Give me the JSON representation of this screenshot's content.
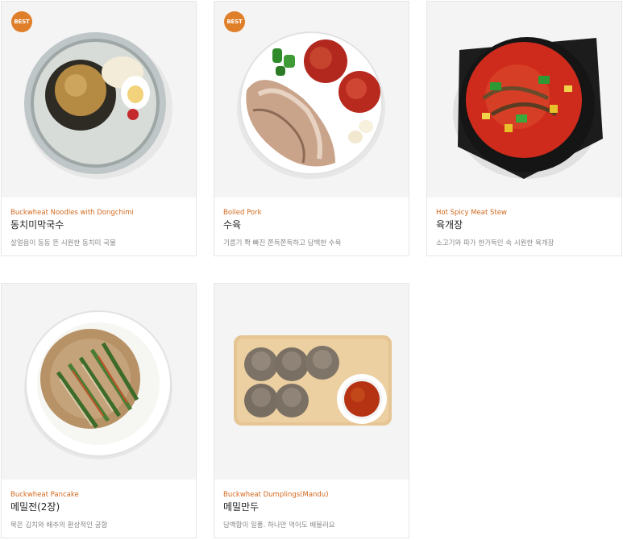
{
  "items": [
    {
      "badge": "BEST",
      "en": "Buckwheat Noodles with Dongchimi",
      "ko": "동치미막국수",
      "desc": "살얼음이 동동 뜬 시원한 동치미 국물"
    },
    {
      "badge": "BEST",
      "en": "Boiled Pork",
      "ko": "수육",
      "desc": "기름기 쫙 빠진 쫀득쫀득하고 담백한 수육"
    },
    {
      "badge": "",
      "en": "Hot Spicy Meat Stew",
      "ko": "육개장",
      "desc": "소고기와 파가 한가득인 속 시원한 육개장"
    },
    {
      "badge": "",
      "en": "Buckwheat Pancake",
      "ko": "메밀전(2장)",
      "desc": "묵은 김치와 배추의 환상적인 궁합"
    },
    {
      "badge": "",
      "en": "Buckwheat Dumplings(Mandu)",
      "ko": "메밀만두",
      "desc": "담백함이 일품. 하나만 먹어도 배불러요"
    }
  ],
  "colors": {
    "accent": "#e07f2a",
    "title_en": "#d2691e"
  }
}
